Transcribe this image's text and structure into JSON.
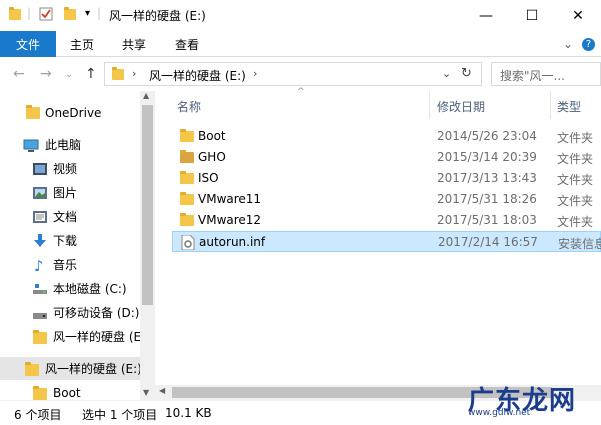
{
  "window": {
    "title": "风一样的硬盘 (E:)",
    "minimize": "—",
    "maximize": "☐",
    "close": "✕"
  },
  "ribbon": {
    "tabs": [
      "文件",
      "主页",
      "共享",
      "查看"
    ],
    "collapse": "⌄",
    "help": "?"
  },
  "address": {
    "path": "风一样的硬盘 (E:)",
    "search_placeholder": "搜索\"风一..."
  },
  "nav": {
    "items": [
      {
        "label": "OneDrive",
        "icon": "onedrive-folder-icon"
      },
      {
        "label": "此电脑",
        "icon": "pc-icon"
      },
      {
        "label": "视频",
        "icon": "video-icon"
      },
      {
        "label": "图片",
        "icon": "pictures-icon"
      },
      {
        "label": "文档",
        "icon": "documents-icon"
      },
      {
        "label": "下载",
        "icon": "download-icon"
      },
      {
        "label": "音乐",
        "icon": "music-icon"
      },
      {
        "label": "本地磁盘 (C:)",
        "icon": "drive-icon"
      },
      {
        "label": "可移动设备 (D:)",
        "icon": "removable-drive-icon"
      },
      {
        "label": "风一样的硬盘 (E",
        "icon": "folder-icon"
      },
      {
        "label": "风一样的硬盘 (E:)",
        "icon": "folder-icon"
      },
      {
        "label": "Boot",
        "icon": "folder-icon"
      }
    ]
  },
  "columns": {
    "name": "名称",
    "modified": "修改日期",
    "type": "类型"
  },
  "files": [
    {
      "name": "Boot",
      "date": "2014/5/26 23:04",
      "type": "文件夹",
      "icon": "folder-icon"
    },
    {
      "name": "GHO",
      "date": "2015/3/14 20:39",
      "type": "文件夹",
      "icon": "folder-gho-icon"
    },
    {
      "name": "ISO",
      "date": "2017/3/13 13:43",
      "type": "文件夹",
      "icon": "folder-icon"
    },
    {
      "name": "VMware11",
      "date": "2017/5/31 18:26",
      "type": "文件夹",
      "icon": "folder-icon"
    },
    {
      "name": "VMware12",
      "date": "2017/5/31 18:03",
      "type": "文件夹",
      "icon": "folder-icon"
    },
    {
      "name": "autorun.inf",
      "date": "2017/2/14 16:57",
      "type": "安装信息",
      "icon": "inf-file-icon",
      "selected": true
    }
  ],
  "status": {
    "count": "6 个项目",
    "selected": "选中 1 个项目",
    "size": "10.1 KB"
  },
  "watermark": {
    "text": "广东龙网",
    "sub": "www.gdlw.net"
  },
  "colors": {
    "accent": "#1979ca",
    "folder": "#f4c64a",
    "selection": "#cce8ff"
  }
}
